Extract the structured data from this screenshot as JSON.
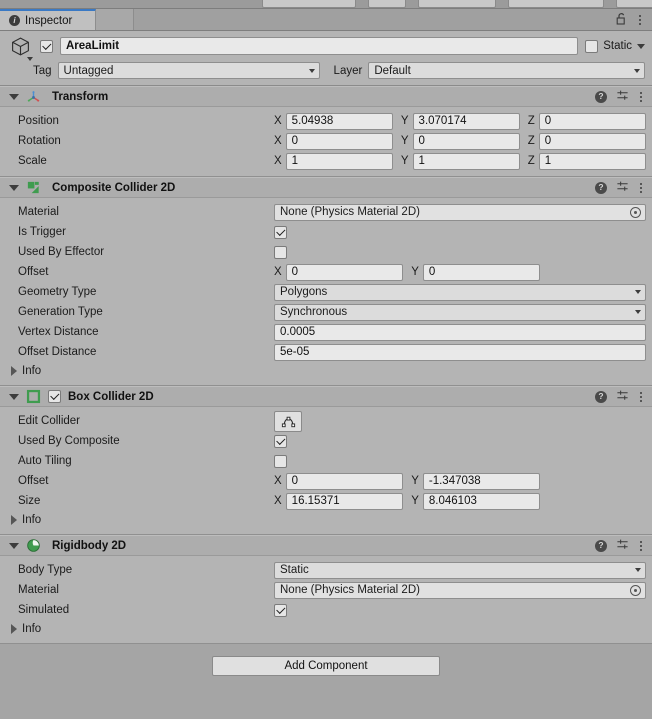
{
  "window": {
    "tab_label": "Inspector",
    "tab_icon": "info-icon",
    "lock_icon": "lock-open-icon",
    "menu_icon": "kebab-menu-icon"
  },
  "gameobject": {
    "icon": "cube-icon",
    "enabled": true,
    "name": "AreaLimit",
    "static_label": "Static",
    "static_checked": false,
    "tag_label": "Tag",
    "tag_value": "Untagged",
    "layer_label": "Layer",
    "layer_value": "Default"
  },
  "components": [
    {
      "title": "Transform",
      "icon": "transform-gizmo-icon",
      "has_enable_toggle": false,
      "expanded": true,
      "rows": [
        {
          "type": "vector3",
          "label": "Position",
          "x": "5.04938",
          "y": "3.070174",
          "z": "0"
        },
        {
          "type": "vector3",
          "label": "Rotation",
          "x": "0",
          "y": "0",
          "z": "0"
        },
        {
          "type": "vector3",
          "label": "Scale",
          "x": "1",
          "y": "1",
          "z": "1"
        }
      ],
      "info_label": null
    },
    {
      "title": "Composite Collider 2D",
      "icon": "composite-collider-icon",
      "has_enable_toggle": false,
      "expanded": true,
      "rows": [
        {
          "type": "object",
          "label": "Material",
          "value": "None (Physics Material 2D)"
        },
        {
          "type": "checkbox",
          "label": "Is Trigger",
          "checked": true
        },
        {
          "type": "checkbox",
          "label": "Used By Effector",
          "checked": false
        },
        {
          "type": "vector2",
          "label": "Offset",
          "x": "0",
          "y": "0"
        },
        {
          "type": "dropdown",
          "label": "Geometry Type",
          "value": "Polygons"
        },
        {
          "type": "dropdown",
          "label": "Generation Type",
          "value": "Synchronous"
        },
        {
          "type": "text",
          "label": "Vertex Distance",
          "value": "0.0005"
        },
        {
          "type": "text",
          "label": "Offset Distance",
          "value": "5e-05"
        }
      ],
      "info_label": "Info"
    },
    {
      "title": "Box Collider 2D",
      "icon": "box-collider-icon",
      "has_enable_toggle": true,
      "enabled": true,
      "expanded": true,
      "rows": [
        {
          "type": "button",
          "label": "Edit Collider",
          "button_icon": "edit-collider-icon"
        },
        {
          "type": "checkbox",
          "label": "Used By Composite",
          "checked": true
        },
        {
          "type": "checkbox",
          "label": "Auto Tiling",
          "checked": false
        },
        {
          "type": "vector2",
          "label": "Offset",
          "x": "0",
          "y": "-1.347038"
        },
        {
          "type": "vector2",
          "label": "Size",
          "x": "16.15371",
          "y": "8.046103"
        }
      ],
      "info_label": "Info"
    },
    {
      "title": "Rigidbody 2D",
      "icon": "rigidbody-icon",
      "has_enable_toggle": false,
      "expanded": true,
      "rows": [
        {
          "type": "dropdown",
          "label": "Body Type",
          "value": "Static"
        },
        {
          "type": "object",
          "label": "Material",
          "value": "None (Physics Material 2D)"
        },
        {
          "type": "checkbox",
          "label": "Simulated",
          "checked": true
        }
      ],
      "info_label": "Info"
    }
  ],
  "header_actions": {
    "help_icon": "help-icon",
    "preset_icon": "preset-sliders-icon",
    "menu_icon": "kebab-menu-icon"
  },
  "footer": {
    "add_component_label": "Add Component"
  },
  "colors": {
    "panel_bg": "#b4b4b4",
    "window_bg": "#a5a5a5",
    "header_bg": "#adadad",
    "field_bg": "#e9e9e9",
    "accent_tab": "#3a79c4",
    "collider_green": "#3f9c4f"
  }
}
